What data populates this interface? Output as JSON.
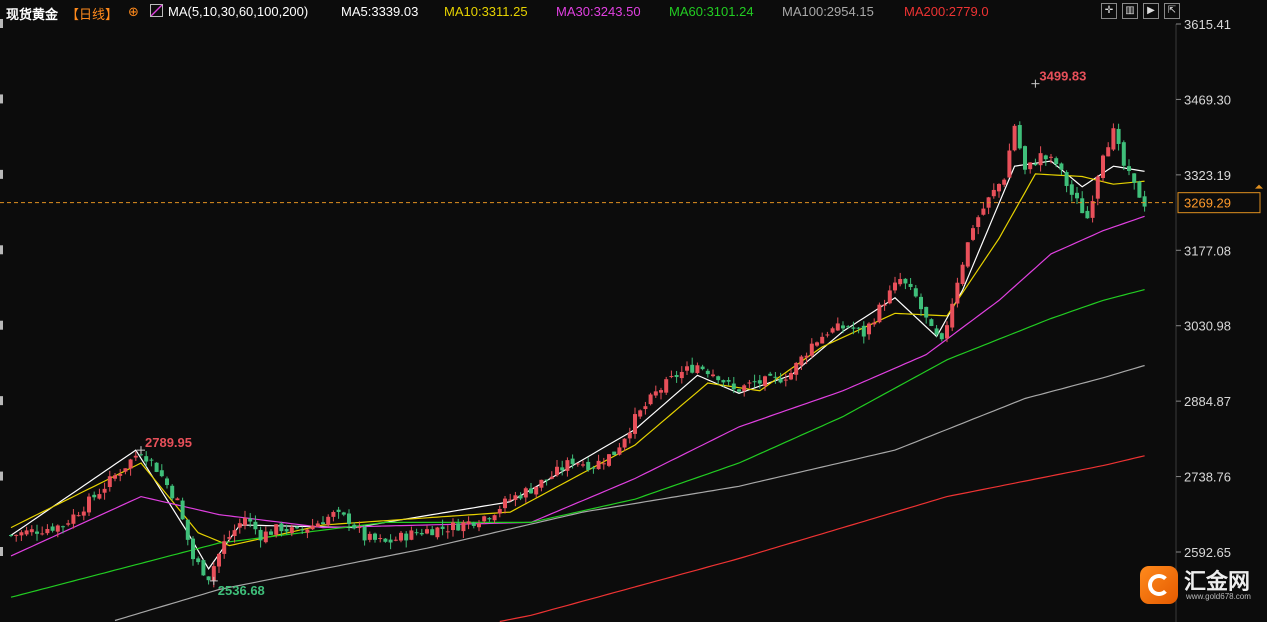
{
  "header": {
    "instrument": "现货黄金",
    "period": "【日线】",
    "target_icon": "target-icon",
    "ma_icon": "ma-chart-icon",
    "ma_params": "MA(5,10,30,60,100,200)",
    "ma_values": [
      {
        "text": "MA5:3339.03",
        "color": "#ffffff"
      },
      {
        "text": "MA10:3311.25",
        "color": "#e6d200"
      },
      {
        "text": "MA30:3243.50",
        "color": "#e040e0"
      },
      {
        "text": "MA60:3101.24",
        "color": "#22cc22"
      },
      {
        "text": "MA100:2954.15",
        "color": "#a8a8a8"
      },
      {
        "text": "MA200:2779.0",
        "color": "#ee3333"
      }
    ]
  },
  "toolbar": {
    "icons": [
      "crosshair-icon",
      "layout-icon",
      "play-icon",
      "expand-icon"
    ]
  },
  "branding": {
    "name": "汇金网",
    "url": "www.gold678.com",
    "icon": "gold678-logo-icon"
  },
  "chart_data": {
    "type": "candlestick",
    "y_axis_ticks": [
      "3615.41",
      "3469.30",
      "3323.19",
      "3177.08",
      "3030.98",
      "2884.87",
      "2738.76",
      "2592.65"
    ],
    "ylim": [
      2530,
      3615.41
    ],
    "current_price": "3269.29",
    "annotations": [
      {
        "text": "3499.83",
        "kind": "high",
        "color": "#e8505a"
      },
      {
        "text": "2789.95",
        "kind": "high",
        "color": "#e8505a"
      },
      {
        "text": "2536.68",
        "kind": "low",
        "color": "#3fbf7a"
      }
    ],
    "close_path": [
      [
        0,
        2625
      ],
      [
        10,
        2645
      ],
      [
        15,
        2690
      ],
      [
        20,
        2740
      ],
      [
        25,
        2790
      ],
      [
        28,
        2755
      ],
      [
        32,
        2690
      ],
      [
        35,
        2580
      ],
      [
        38,
        2545
      ],
      [
        41,
        2610
      ],
      [
        45,
        2660
      ],
      [
        48,
        2625
      ],
      [
        52,
        2640
      ],
      [
        55,
        2630
      ],
      [
        58,
        2645
      ],
      [
        62,
        2665
      ],
      [
        65,
        2655
      ],
      [
        68,
        2620
      ],
      [
        72,
        2610
      ],
      [
        76,
        2625
      ],
      [
        80,
        2635
      ],
      [
        84,
        2640
      ],
      [
        88,
        2650
      ],
      [
        92,
        2665
      ],
      [
        96,
        2695
      ],
      [
        100,
        2715
      ],
      [
        104,
        2740
      ],
      [
        108,
        2770
      ],
      [
        112,
        2760
      ],
      [
        116,
        2785
      ],
      [
        120,
        2850
      ],
      [
        124,
        2900
      ],
      [
        128,
        2935
      ],
      [
        132,
        2955
      ],
      [
        136,
        2935
      ],
      [
        139,
        2905
      ],
      [
        143,
        2920
      ],
      [
        147,
        2925
      ],
      [
        150,
        2940
      ],
      [
        154,
        2995
      ],
      [
        157,
        3020
      ],
      [
        161,
        3030
      ],
      [
        164,
        3015
      ],
      [
        168,
        3080
      ],
      [
        171,
        3120
      ],
      [
        174,
        3085
      ],
      [
        177,
        3020
      ],
      [
        179,
        2995
      ],
      [
        182,
        3120
      ],
      [
        185,
        3225
      ],
      [
        188,
        3275
      ],
      [
        191,
        3320
      ],
      [
        193,
        3420
      ],
      [
        195,
        3330
      ],
      [
        198,
        3360
      ],
      [
        201,
        3345
      ],
      [
        204,
        3285
      ],
      [
        207,
        3240
      ],
      [
        210,
        3370
      ],
      [
        212,
        3405
      ],
      [
        214,
        3340
      ],
      [
        216,
        3300
      ],
      [
        218,
        3269
      ]
    ],
    "ma_series": [
      {
        "name": "MA5",
        "color": "#ffffff",
        "values": [
          [
            0,
            2625
          ],
          [
            24,
            2790
          ],
          [
            34,
            2630
          ],
          [
            38,
            2560
          ],
          [
            44,
            2645
          ],
          [
            66,
            2640
          ],
          [
            96,
            2690
          ],
          [
            120,
            2830
          ],
          [
            132,
            2935
          ],
          [
            140,
            2900
          ],
          [
            150,
            2935
          ],
          [
            160,
            3020
          ],
          [
            170,
            3085
          ],
          [
            178,
            3010
          ],
          [
            183,
            3100
          ],
          [
            193,
            3340
          ],
          [
            200,
            3350
          ],
          [
            206,
            3300
          ],
          [
            212,
            3340
          ],
          [
            218,
            3330
          ]
        ]
      },
      {
        "name": "MA10",
        "color": "#e6d200",
        "values": [
          [
            0,
            2640
          ],
          [
            25,
            2765
          ],
          [
            36,
            2630
          ],
          [
            42,
            2605
          ],
          [
            60,
            2645
          ],
          [
            96,
            2670
          ],
          [
            120,
            2800
          ],
          [
            134,
            2920
          ],
          [
            144,
            2905
          ],
          [
            156,
            2990
          ],
          [
            170,
            3055
          ],
          [
            180,
            3050
          ],
          [
            190,
            3200
          ],
          [
            197,
            3325
          ],
          [
            206,
            3320
          ],
          [
            212,
            3305
          ],
          [
            218,
            3311
          ]
        ]
      },
      {
        "name": "MA30",
        "color": "#e040e0",
        "values": [
          [
            0,
            2585
          ],
          [
            25,
            2700
          ],
          [
            40,
            2665
          ],
          [
            60,
            2640
          ],
          [
            100,
            2650
          ],
          [
            120,
            2735
          ],
          [
            140,
            2835
          ],
          [
            160,
            2905
          ],
          [
            176,
            2975
          ],
          [
            190,
            3080
          ],
          [
            200,
            3170
          ],
          [
            210,
            3215
          ],
          [
            218,
            3243
          ]
        ]
      },
      {
        "name": "MA60",
        "color": "#22cc22",
        "values": [
          [
            0,
            2505
          ],
          [
            40,
            2610
          ],
          [
            72,
            2650
          ],
          [
            100,
            2650
          ],
          [
            120,
            2695
          ],
          [
            140,
            2765
          ],
          [
            160,
            2855
          ],
          [
            180,
            2965
          ],
          [
            200,
            3045
          ],
          [
            210,
            3080
          ],
          [
            218,
            3101
          ]
        ]
      },
      {
        "name": "MA100",
        "color": "#a8a8a8",
        "values": [
          [
            0,
            2400
          ],
          [
            40,
            2520
          ],
          [
            80,
            2600
          ],
          [
            110,
            2670
          ],
          [
            140,
            2720
          ],
          [
            170,
            2790
          ],
          [
            195,
            2890
          ],
          [
            210,
            2930
          ],
          [
            218,
            2954
          ]
        ]
      },
      {
        "name": "MA200",
        "color": "#ee3333",
        "values": [
          [
            0,
            2250
          ],
          [
            60,
            2390
          ],
          [
            100,
            2470
          ],
          [
            140,
            2580
          ],
          [
            180,
            2700
          ],
          [
            210,
            2760
          ],
          [
            218,
            2779
          ]
        ]
      }
    ]
  }
}
